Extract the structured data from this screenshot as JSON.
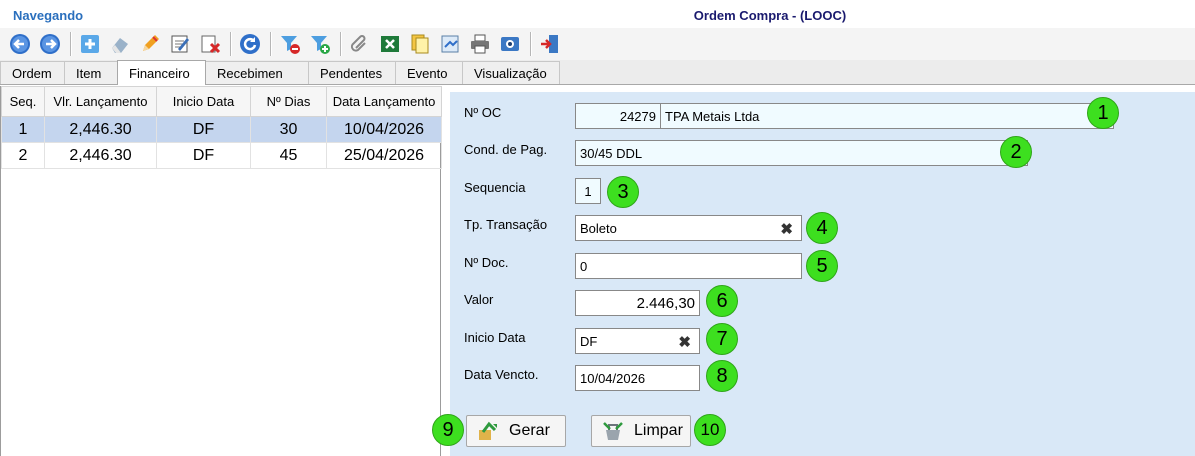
{
  "header": {
    "status": "Navegando",
    "title": "Ordem Compra - (LOOC)"
  },
  "toolbar": {
    "buttons": [
      {
        "icon": "arrow-left-circle-icon"
      },
      {
        "icon": "arrow-right-circle-icon"
      },
      {
        "icon": "add-icon"
      },
      {
        "icon": "eraser-icon"
      },
      {
        "icon": "pencil-icon"
      },
      {
        "icon": "edit-form-icon"
      },
      {
        "icon": "delete-icon"
      },
      {
        "icon": "refresh-icon"
      },
      {
        "icon": "filter-remove-icon"
      },
      {
        "icon": "filter-add-icon"
      },
      {
        "icon": "paperclip-icon"
      },
      {
        "icon": "excel-icon"
      },
      {
        "icon": "copy-icon"
      },
      {
        "icon": "export-icon"
      },
      {
        "icon": "print-icon"
      },
      {
        "icon": "preview-icon"
      },
      {
        "icon": "exit-door-icon"
      }
    ]
  },
  "tabs": [
    "Ordem",
    "Item",
    "Financeiro",
    "Recebimen",
    "Pendentes",
    "Evento",
    "Visualização"
  ],
  "active_tab": "Financeiro",
  "grid": {
    "columns": [
      "Seq.",
      "Vlr. Lançamento",
      "Inicio Data",
      "Nº Dias",
      "Data Lançamento"
    ],
    "rows": [
      {
        "seq": "1",
        "valor": "2,446.30",
        "inicio": "DF",
        "dias": "30",
        "data": "10/04/2026"
      },
      {
        "seq": "2",
        "valor": "2,446.30",
        "inicio": "DF",
        "dias": "45",
        "data": "25/04/2026"
      }
    ]
  },
  "form": {
    "oc_label": "Nº OC",
    "oc_number": "24279",
    "oc_supplier": "TPA Metais Ltda",
    "cond_label": "Cond. de Pag.",
    "cond_value": "30/45 DDL",
    "seq_label": "Sequencia",
    "seq_value": "1",
    "tp_label": "Tp. Transação",
    "tp_value": "Boleto",
    "doc_label": "Nº Doc.",
    "doc_value": "0",
    "valor_label": "Valor",
    "valor_value": "2.446,30",
    "inicio_label": "Inicio Data",
    "inicio_value": "DF",
    "vencto_label": "Data Vencto.",
    "vencto_value": "10/04/2026",
    "clear_glyph": "✖"
  },
  "buttons": {
    "gerar": "Gerar",
    "limpar": "Limpar"
  },
  "badges": [
    "1",
    "2",
    "3",
    "4",
    "5",
    "6",
    "7",
    "8",
    "9",
    "10"
  ],
  "colors": {
    "badge": "#3ddf1f",
    "form_bg": "#d9e8f7",
    "selected_row": "#c4d5ee",
    "status_text": "#2a6fbd",
    "title_text": "#1a1a6e"
  }
}
